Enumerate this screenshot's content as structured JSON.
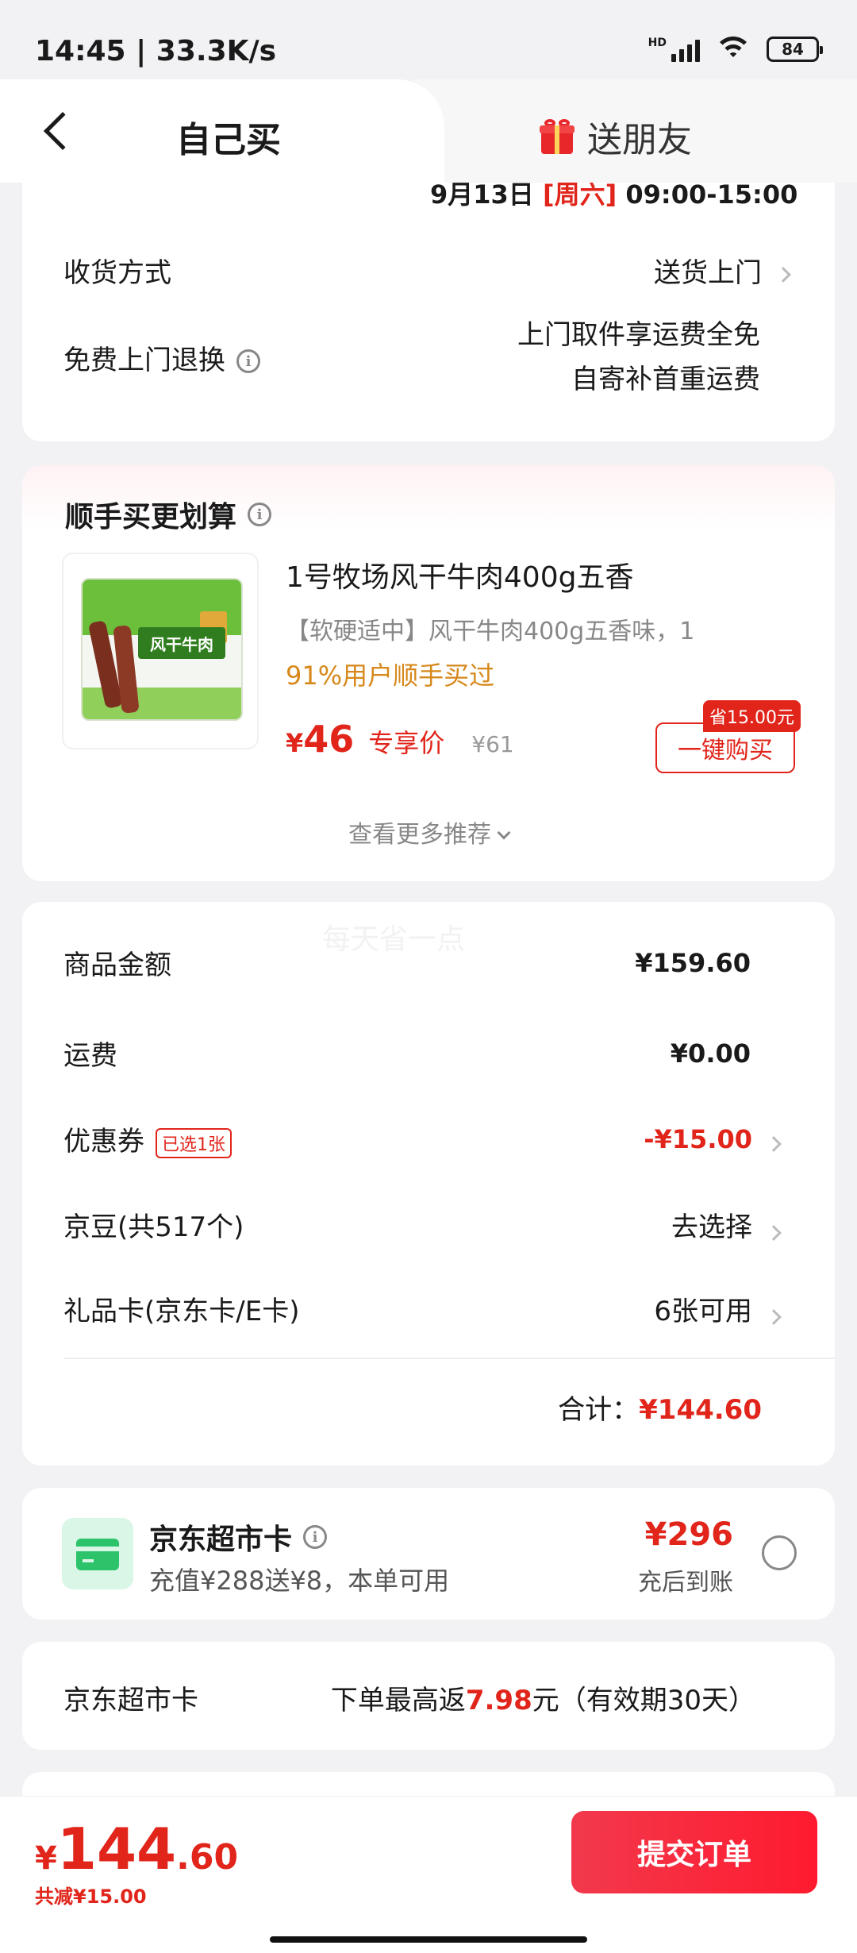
{
  "status": {
    "time": "14:45 | 33.3K/s",
    "battery": "84",
    "network": "HD"
  },
  "header": {
    "tab_self": "自己买",
    "tab_gift": "送朋友"
  },
  "delivery": {
    "time_prefix": "9月13日",
    "time_day": "[周六]",
    "time_range": "09:00-15:00",
    "method_label": "收货方式",
    "method_value": "送货上门",
    "return_label": "免费上门退换",
    "return_line1": "上门取件享运费全免",
    "return_line2": "自寄补首重运费"
  },
  "addon": {
    "title": "顺手买更划算",
    "product_name": "1号牧场风干牛肉400g五香",
    "product_desc": "【软硬适中】风干牛肉400g五香味，1",
    "rate": "91%用户顺手买过",
    "price_yen": "¥",
    "price": "46",
    "price_tag": "专享价",
    "original_price": "¥61",
    "save_badge": "省15.00元",
    "buy_button": "一键购买",
    "more": "查看更多推荐",
    "image_brand": "风干牛肉"
  },
  "summary": {
    "watermark": "每天省一点",
    "rows": [
      {
        "label": "商品金额",
        "value": "¥159.60"
      },
      {
        "label": "运费",
        "value": "¥0.00"
      },
      {
        "label": "优惠券",
        "badge": "已选1张",
        "value": "-¥15.00"
      },
      {
        "label": "京豆(共517个)",
        "value": "去选择"
      },
      {
        "label": "礼品卡(京东卡/E卡)",
        "value": "6张可用"
      }
    ],
    "total_label": "合计：",
    "total_value": "¥144.60"
  },
  "supermarket_card": {
    "title": "京东超市卡",
    "subtitle": "充值¥288送¥8，本单可用",
    "price": "¥296",
    "after": "充后到账"
  },
  "supermarket_rebate": {
    "label": "京东超市卡",
    "value_prefix": "下单最高返",
    "value_amount": "7.98",
    "value_suffix": "元（有效期30天）"
  },
  "bottom": {
    "yen": "¥",
    "total_int": "144",
    "total_dec": ".60",
    "saved": "共减¥15.00",
    "submit": "提交订单"
  },
  "colors": {
    "accent": "#e1251b",
    "orange": "#d7881a",
    "green": "#2cc36b"
  }
}
